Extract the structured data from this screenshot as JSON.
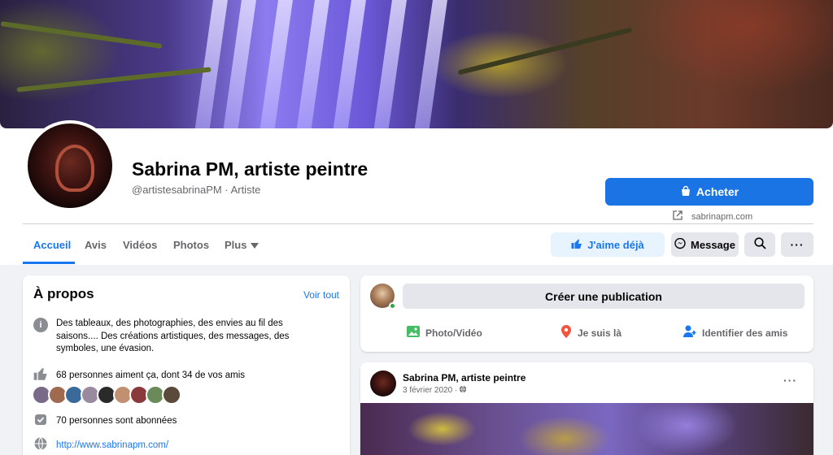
{
  "page": {
    "title": "Sabrina PM, artiste peintre",
    "subtitle": "@artistesabrinaPM · Artiste"
  },
  "actions": {
    "buy_label": "Acheter",
    "website": "sabrinapm.com",
    "like_label": "J'aime déjà",
    "message_label": "Message"
  },
  "tabs": [
    {
      "label": "Accueil",
      "active": true
    },
    {
      "label": "Avis"
    },
    {
      "label": "Vidéos"
    },
    {
      "label": "Photos"
    },
    {
      "label": "Plus"
    }
  ],
  "about": {
    "title": "À propos",
    "see_all": "Voir tout",
    "description": "Des tableaux, des photographies, des envies au fil des saisons.... Des créations artistiques, des messages, des symboles, une évasion.",
    "likes": "68 personnes aiment ça, dont 34 de vos amis",
    "followers": "70 personnes sont abonnées",
    "website": "http://www.sabrinapm.com/"
  },
  "composer": {
    "placeholder": "Créer une publication",
    "photo_video": "Photo/Vidéo",
    "checkin": "Je suis là",
    "tag_friends": "Identifier des amis"
  },
  "post": {
    "author": "Sabrina PM, artiste peintre",
    "date": "3 février 2020 · "
  },
  "colors": {
    "accent": "#1877f2",
    "button_blue": "#1b74e4",
    "background": "#f0f2f5"
  }
}
